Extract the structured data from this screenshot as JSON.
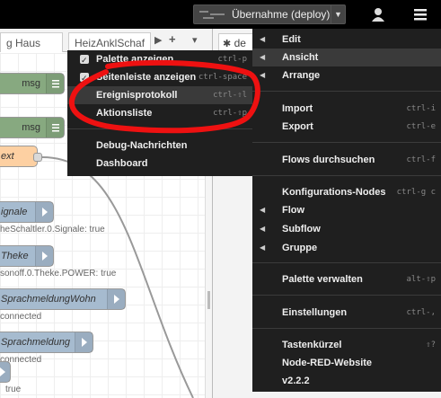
{
  "header": {
    "deploy_label": "Übernahme (deploy)"
  },
  "tabs": {
    "tab1_label": "g Haus",
    "tab2_label": "HeizAnklSchaf",
    "sidebar_tab_label": "de"
  },
  "workspace": {
    "nodes": [
      {
        "label": "msg"
      },
      {
        "label": "msg"
      },
      {
        "label": "ext"
      },
      {
        "label": "ignale",
        "status": "heSchaltler.0.Signale: true"
      },
      {
        "label": "Theke",
        "status": "sonoff.0.Theke.POWER: true"
      },
      {
        "label": "SprachmeldungWohn",
        "status": "connected"
      },
      {
        "label": "Sprachmeldung",
        "status": "connected"
      },
      {
        "label": "",
        "status": "true"
      }
    ]
  },
  "main_menu": {
    "items": [
      {
        "label": "Edit",
        "shortcut": ""
      },
      {
        "label": "Ansicht",
        "shortcut": ""
      },
      {
        "label": "Arrange",
        "shortcut": ""
      },
      {
        "label": "Import",
        "shortcut": "ctrl-i"
      },
      {
        "label": "Export",
        "shortcut": "ctrl-e"
      },
      {
        "label": "Flows durchsuchen",
        "shortcut": "ctrl-f"
      },
      {
        "label": "Konfigurations-Nodes",
        "shortcut": "ctrl-g c"
      },
      {
        "label": "Flow",
        "shortcut": ""
      },
      {
        "label": "Subflow",
        "shortcut": ""
      },
      {
        "label": "Gruppe",
        "shortcut": ""
      },
      {
        "label": "Palette verwalten",
        "shortcut": "alt-⇧p"
      },
      {
        "label": "Einstellungen",
        "shortcut": "ctrl-,"
      },
      {
        "label": "Tastenkürzel",
        "shortcut": "⇧?"
      },
      {
        "label": "Node-RED-Website",
        "shortcut": ""
      },
      {
        "label": "v2.2.2",
        "shortcut": ""
      }
    ]
  },
  "view_submenu": {
    "items": [
      {
        "label": "Palette anzeigen",
        "shortcut": "ctrl-p"
      },
      {
        "label": "Seitenleiste anzeigen",
        "shortcut": "ctrl-space"
      },
      {
        "label": "Ereignisprotokoll",
        "shortcut": "ctrl-⇧l"
      },
      {
        "label": "Aktionsliste",
        "shortcut": "ctrl-⇧p"
      },
      {
        "label": "Debug-Nachrichten",
        "shortcut": ""
      },
      {
        "label": "Dashboard",
        "shortcut": ""
      }
    ]
  },
  "colors": {
    "header": "#000000",
    "menu_bg": "#1f1f1f",
    "annotation_red": "#ee1111",
    "node_green": "#87a980",
    "node_blue": "#a6bbcf",
    "node_orange": "#fdd0a2"
  }
}
